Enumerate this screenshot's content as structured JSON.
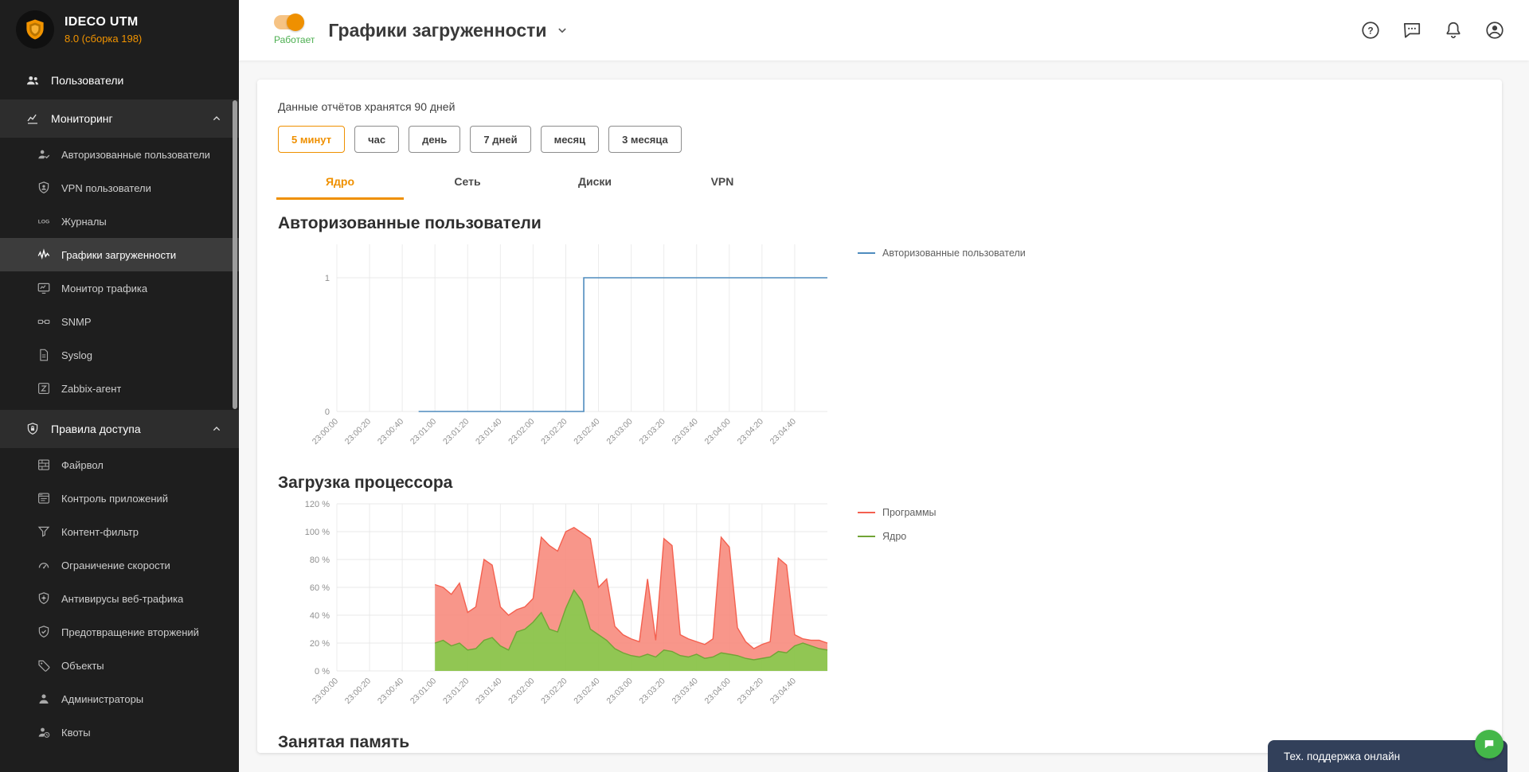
{
  "app": {
    "name": "IDECO UTM",
    "version": "8.0 (сборка 198)"
  },
  "colors": {
    "accent": "#ef9000",
    "status_ok": "#4caf50",
    "sidebar_bg": "#1e1e1e",
    "chat_bg": "#32405a",
    "chat_badge": "#44b749",
    "users_line": "#4e8cbe",
    "cpu_programs_stroke": "#f4604f",
    "cpu_programs_fill": "#f78b7d",
    "cpu_kernel_stroke": "#71a436",
    "cpu_kernel_fill": "#8bc34a"
  },
  "sidebar": {
    "sections": [
      {
        "id": "users",
        "type": "item",
        "icon": "users",
        "label": "Пользователи"
      },
      {
        "id": "monitoring",
        "type": "group",
        "icon": "monitoring",
        "label": "Мониторинг",
        "expanded": true,
        "items": [
          {
            "id": "authorized-users",
            "icon": "user-check",
            "label": "Авторизованные пользователи"
          },
          {
            "id": "vpn-users",
            "icon": "vpn-user",
            "label": "VPN пользователи"
          },
          {
            "id": "logs",
            "icon": "log",
            "label": "Журналы"
          },
          {
            "id": "load-graphs",
            "icon": "load-graphs",
            "label": "Графики загруженности",
            "active": true
          },
          {
            "id": "traffic-monitor",
            "icon": "traffic-monitor",
            "label": "Монитор трафика"
          },
          {
            "id": "snmp",
            "icon": "snmp",
            "label": "SNMP"
          },
          {
            "id": "syslog",
            "icon": "syslog",
            "label": "Syslog"
          },
          {
            "id": "zabbix-agent",
            "icon": "zabbix",
            "label": "Zabbix-агент"
          }
        ]
      },
      {
        "id": "access-rules",
        "type": "group",
        "icon": "access-rules",
        "label": "Правила доступа",
        "expanded": true,
        "items": [
          {
            "id": "firewall",
            "icon": "firewall",
            "label": "Файрвол"
          },
          {
            "id": "app-control",
            "icon": "app-control",
            "label": "Контроль приложений"
          },
          {
            "id": "content-filter",
            "icon": "content-filter",
            "label": "Контент-фильтр"
          },
          {
            "id": "speed-limit",
            "icon": "speed-limit",
            "label": "Ограничение скорости"
          },
          {
            "id": "web-antivirus",
            "icon": "antivirus",
            "label": "Антивирусы веб-трафика"
          },
          {
            "id": "intrusion-prevention",
            "icon": "ips",
            "label": "Предотвращение вторжений"
          },
          {
            "id": "objects",
            "icon": "objects",
            "label": "Объекты"
          },
          {
            "id": "admins",
            "icon": "admins",
            "label": "Администраторы"
          },
          {
            "id": "quotas",
            "icon": "quotas",
            "label": "Квоты"
          }
        ]
      }
    ]
  },
  "header": {
    "title": "Графики загруженности",
    "status": "Работает",
    "toggle_on": true
  },
  "content": {
    "retention_note": "Данные отчётов хранятся 90 дней",
    "ranges": [
      {
        "id": "5min",
        "label": "5 минут",
        "active": true
      },
      {
        "id": "hour",
        "label": "час"
      },
      {
        "id": "day",
        "label": "день"
      },
      {
        "id": "7days",
        "label": "7 дней"
      },
      {
        "id": "month",
        "label": "месяц"
      },
      {
        "id": "3months",
        "label": "3 месяца"
      }
    ],
    "tabs": [
      {
        "id": "kernel",
        "label": "Ядро",
        "active": true
      },
      {
        "id": "network",
        "label": "Сеть"
      },
      {
        "id": "disks",
        "label": "Диски"
      },
      {
        "id": "vpn",
        "label": "VPN"
      }
    ],
    "section_titles": [
      "Авторизованные пользователи",
      "Загрузка процессора",
      "Занятая память"
    ]
  },
  "chat": {
    "label": "Тех. поддержка онлайн"
  },
  "chart_data": [
    {
      "type": "line",
      "title": "Авторизованные пользователи",
      "x_base": "23:00:00",
      "x_unit": "seconds since 23:00:00",
      "x_domain_s": [
        0,
        300
      ],
      "xtick_interval_s": 20,
      "xtick_labels": [
        "23:00:00",
        "23:00:20",
        "23:00:40",
        "23:01:00",
        "23:01:20",
        "23:01:40",
        "23:02:00",
        "23:02:20",
        "23:02:40",
        "23:03:00",
        "23:03:20",
        "23:03:40",
        "23:04:00",
        "23:04:20",
        "23:04:40"
      ],
      "y_domain": [
        0,
        1.25
      ],
      "yticks": [
        {
          "v": 0,
          "label": "0"
        },
        {
          "v": 1,
          "label": "1"
        }
      ],
      "grid": true,
      "legend_position": "right",
      "series": [
        {
          "name": "Авторизованные пользователи",
          "type": "step",
          "color": "#4e8cbe",
          "points_s_v": [
            [
              50,
              0
            ],
            [
              151,
              0
            ],
            [
              151,
              1
            ],
            [
              300,
              1
            ]
          ]
        }
      ]
    },
    {
      "type": "area",
      "title": "Загрузка процессора",
      "stacked": true,
      "x_base": "23:00:00",
      "x_unit": "seconds since 23:00:00",
      "x_domain_s": [
        0,
        300
      ],
      "xtick_interval_s": 20,
      "xtick_labels": [
        "23:00:00",
        "23:00:20",
        "23:00:40",
        "23:01:00",
        "23:01:20",
        "23:01:40",
        "23:02:00",
        "23:02:20",
        "23:02:40",
        "23:03:00",
        "23:03:20",
        "23:03:40",
        "23:04:00",
        "23:04:20",
        "23:04:40"
      ],
      "y_domain": [
        0,
        120
      ],
      "yticks": [
        {
          "v": 0,
          "label": "0 %"
        },
        {
          "v": 20,
          "label": "20 %"
        },
        {
          "v": 40,
          "label": "40 %"
        },
        {
          "v": 60,
          "label": "60 %"
        },
        {
          "v": 80,
          "label": "80 %"
        },
        {
          "v": 100,
          "label": "100 %"
        },
        {
          "v": 120,
          "label": "120 %"
        }
      ],
      "grid": true,
      "legend_position": "right",
      "x_s": [
        60,
        65,
        70,
        75,
        80,
        85,
        90,
        95,
        100,
        105,
        110,
        115,
        120,
        125,
        130,
        135,
        140,
        145,
        150,
        155,
        160,
        165,
        170,
        175,
        180,
        185,
        190,
        195,
        200,
        205,
        210,
        215,
        220,
        225,
        230,
        235,
        240,
        245,
        250,
        255,
        260,
        265,
        270,
        275,
        280,
        285,
        290,
        295,
        300
      ],
      "stack_order_bottom_to_top": [
        "Ядро",
        "Программы"
      ],
      "series": [
        {
          "name": "Программы",
          "color": "#f4604f",
          "fill": "#f78b7d",
          "values": [
            42,
            38,
            37,
            43,
            27,
            30,
            58,
            52,
            28,
            25,
            16,
            16,
            17,
            54,
            60,
            58,
            55,
            45,
            49,
            65,
            34,
            44,
            16,
            13,
            12,
            11,
            54,
            12,
            80,
            76,
            15,
            13,
            9,
            10,
            13,
            83,
            77,
            20,
            12,
            8,
            10,
            11,
            67,
            63,
            8,
            3,
            4,
            6,
            5
          ]
        },
        {
          "name": "Ядро",
          "color": "#71a436",
          "fill": "#8bc34a",
          "values": [
            20,
            22,
            18,
            20,
            15,
            16,
            22,
            24,
            18,
            15,
            28,
            30,
            35,
            42,
            30,
            28,
            45,
            58,
            50,
            30,
            26,
            22,
            16,
            13,
            11,
            10,
            12,
            10,
            15,
            14,
            11,
            10,
            12,
            9,
            10,
            13,
            12,
            11,
            9,
            8,
            9,
            10,
            14,
            13,
            18,
            20,
            18,
            16,
            15
          ]
        }
      ]
    }
  ]
}
